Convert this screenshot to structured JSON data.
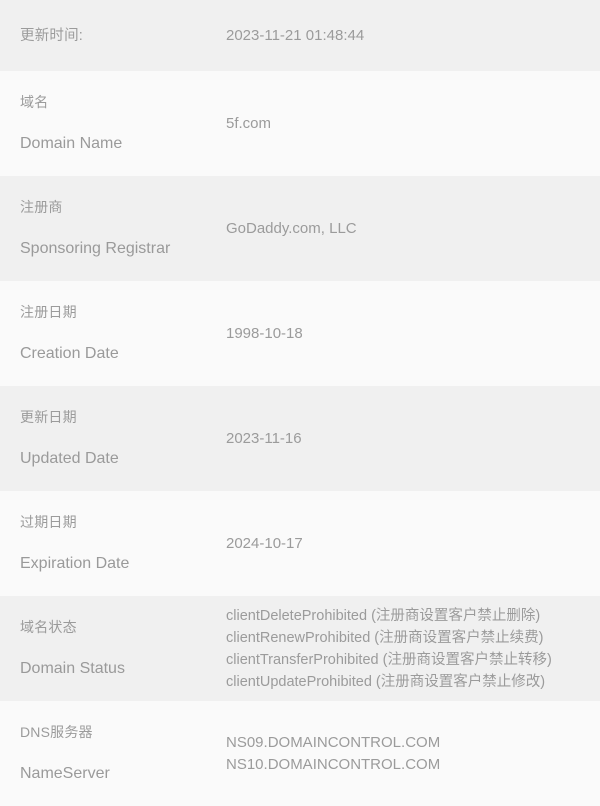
{
  "table": {
    "rows": [
      {
        "label_cn": "更新时间:",
        "label_en": "",
        "values": [
          "2023-11-21 01:48:44"
        ]
      },
      {
        "label_cn": "域名",
        "label_en": "Domain Name",
        "values": [
          "5f.com"
        ]
      },
      {
        "label_cn": "注册商",
        "label_en": "Sponsoring Registrar",
        "values": [
          "GoDaddy.com, LLC"
        ]
      },
      {
        "label_cn": "注册日期",
        "label_en": "Creation Date",
        "values": [
          "1998-10-18"
        ]
      },
      {
        "label_cn": "更新日期",
        "label_en": "Updated Date",
        "values": [
          "2023-11-16"
        ]
      },
      {
        "label_cn": "过期日期",
        "label_en": "Expiration Date",
        "values": [
          "2024-10-17"
        ]
      },
      {
        "label_cn": "域名状态",
        "label_en": "Domain Status",
        "values": [
          "clientDeleteProhibited (注册商设置客户禁止删除)",
          "clientRenewProhibited (注册商设置客户禁止续费)",
          "clientTransferProhibited (注册商设置客户禁止转移)",
          "clientUpdateProhibited (注册商设置客户禁止修改)"
        ]
      },
      {
        "label_cn": "DNS服务器",
        "label_en": "NameServer",
        "values": [
          "NS09.DOMAINCONTROL.COM",
          "NS10.DOMAINCONTROL.COM"
        ]
      }
    ]
  },
  "colors": {
    "row_shade_dark": "#f0f0f0",
    "row_shade_light": "#fafafa",
    "label_text": "#9b9b9b",
    "value_text": "#9b9b9b"
  }
}
